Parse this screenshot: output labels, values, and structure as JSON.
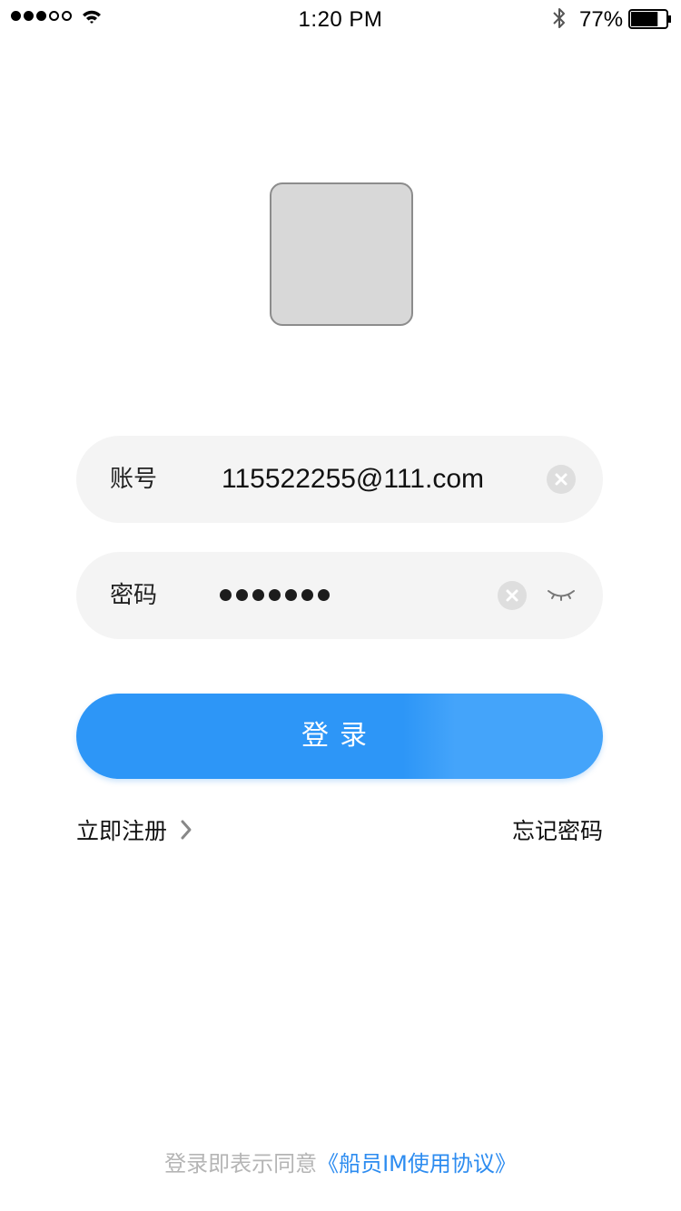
{
  "status_bar": {
    "time": "1:20 PM",
    "battery_percent": "77%",
    "battery_level": 0.77,
    "signal_bars_filled": 3,
    "signal_bars_total": 5,
    "icons": [
      "signal-icon",
      "wifi-icon",
      "bluetooth-icon",
      "battery-icon"
    ]
  },
  "logo": {
    "icon": "logo-placeholder",
    "fill_color": "#d8d8d8"
  },
  "form": {
    "account": {
      "label": "账号",
      "value": "115522255@111.com",
      "clear_icon": "close-icon"
    },
    "password": {
      "label": "密码",
      "masked_length": 7,
      "clear_icon": "close-icon",
      "toggle_icon": "eye-closed-icon"
    },
    "login_button": {
      "label": "登录",
      "color": "#2d96f7"
    }
  },
  "links": {
    "register": "立即注册",
    "register_icon": "chevron-right-icon",
    "forgot_password": "忘记密码"
  },
  "footer": {
    "agreement_prefix": "登录即表示同意",
    "agreement_link": "《船员IM使用协议》",
    "link_color": "#2d8cf0"
  }
}
